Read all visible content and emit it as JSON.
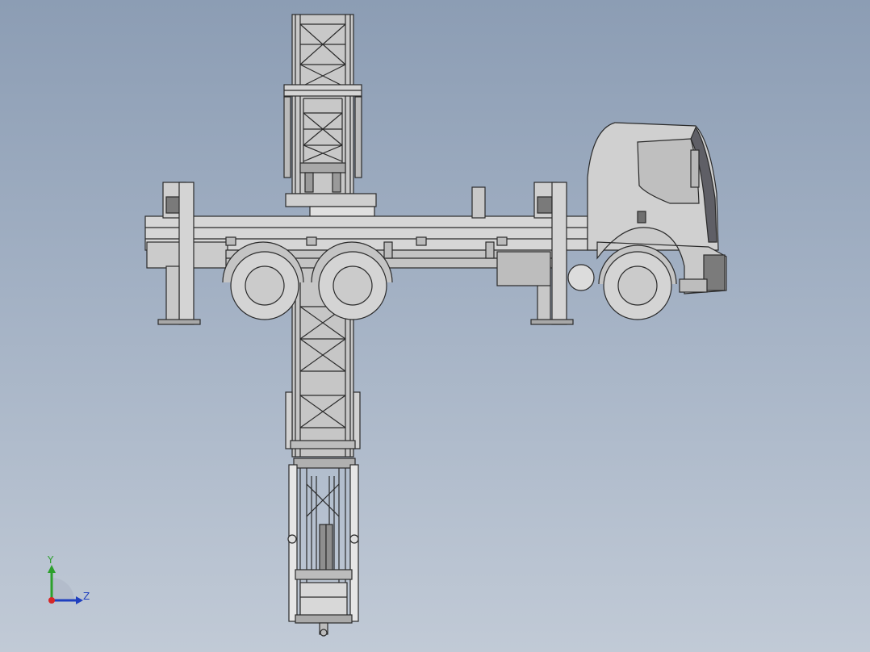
{
  "viewport": {
    "background_top": "#8c9db4",
    "background_bottom": "#c1cad6",
    "model": "truck-mounted-bridge-inspection-unit"
  },
  "triad": {
    "y_label": "Y",
    "z_label": "Z",
    "y_color": "#2ca02c",
    "z_color": "#1f3fbf",
    "x_color": "#d62728"
  },
  "colors": {
    "line": "#2a2a2a",
    "fill_light": "#d9d9d9",
    "fill_mid": "#bdbdbd",
    "fill_dark": "#8e8e8e"
  }
}
